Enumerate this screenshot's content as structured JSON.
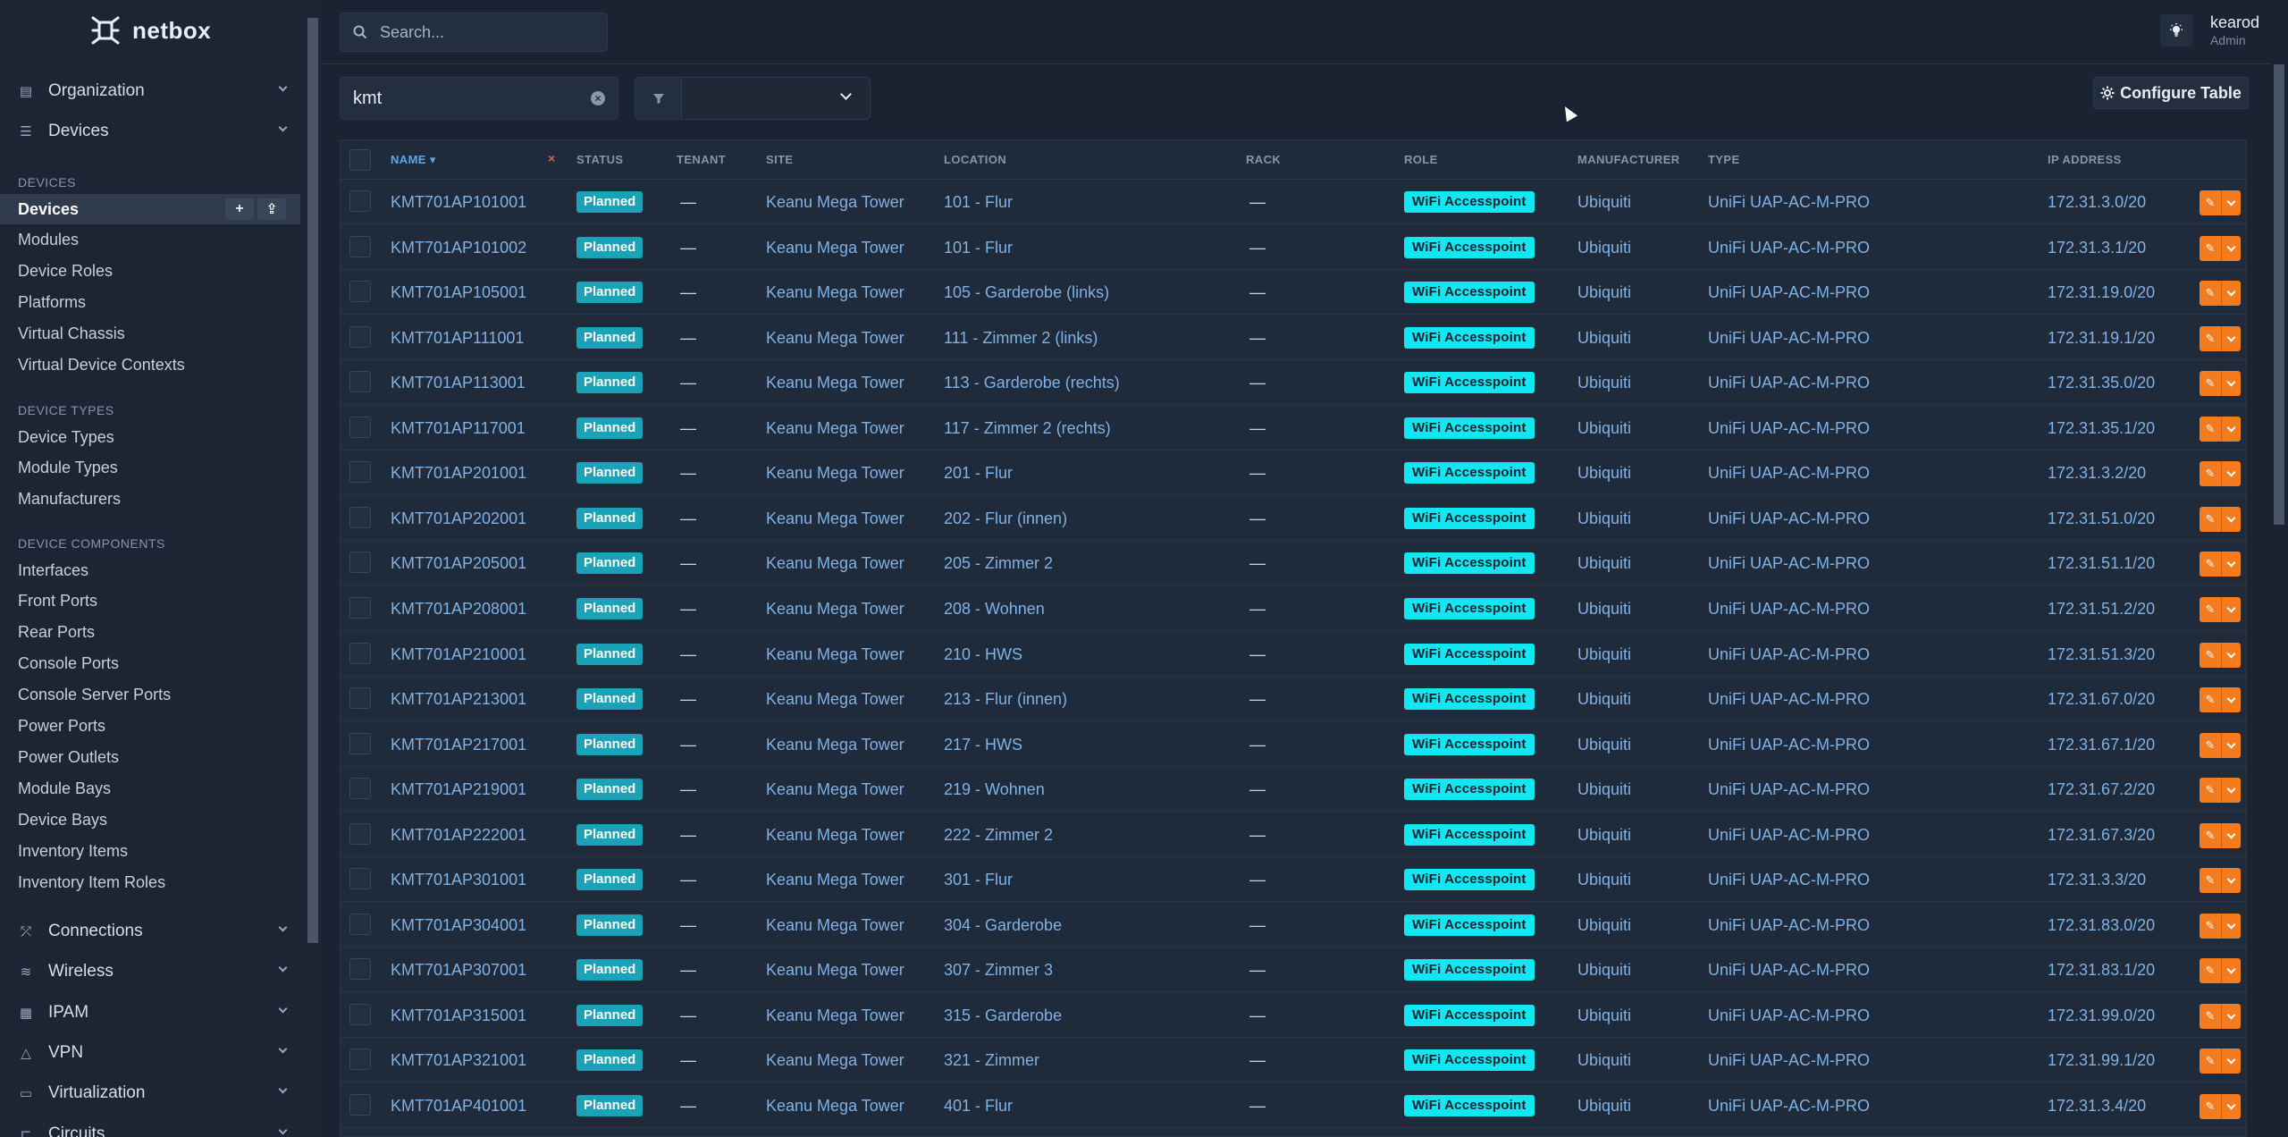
{
  "brand": {
    "name": "netbox"
  },
  "search": {
    "placeholder": "Search..."
  },
  "user": {
    "name": "kearod",
    "role": "Admin"
  },
  "sidebar": {
    "groups_top": [
      {
        "label": "Organization",
        "icon": "building-icon"
      },
      {
        "label": "Devices",
        "icon": "server-icon"
      }
    ],
    "sections": [
      {
        "title": "Devices",
        "items": [
          "Devices",
          "Modules",
          "Device Roles",
          "Platforms",
          "Virtual Chassis",
          "Virtual Device Contexts"
        ]
      },
      {
        "title": "Device Types",
        "items": [
          "Device Types",
          "Module Types",
          "Manufacturers"
        ]
      },
      {
        "title": "Device Components",
        "items": [
          "Interfaces",
          "Front Ports",
          "Rear Ports",
          "Console Ports",
          "Console Server Ports",
          "Power Ports",
          "Power Outlets",
          "Module Bays",
          "Device Bays",
          "Inventory Items",
          "Inventory Item Roles"
        ]
      }
    ],
    "groups_bottom": [
      {
        "label": "Connections",
        "icon": "connections-icon"
      },
      {
        "label": "Wireless",
        "icon": "wifi-icon"
      },
      {
        "label": "IPAM",
        "icon": "ipam-icon"
      },
      {
        "label": "VPN",
        "icon": "vpn-icon"
      },
      {
        "label": "Virtualization",
        "icon": "monitor-icon"
      },
      {
        "label": "Circuits",
        "icon": "circuits-icon"
      }
    ],
    "active_item": "Devices",
    "add_symbol": "+",
    "import_symbol": "⇪"
  },
  "filter": {
    "quick_search": "kmt",
    "selected": ""
  },
  "toolbar": {
    "configure_label": "Configure Table"
  },
  "table": {
    "columns": [
      "Name",
      "Status",
      "Tenant",
      "Site",
      "Location",
      "Rack",
      "Role",
      "Manufacturer",
      "Type",
      "IP Address"
    ],
    "sorted_column": "Name",
    "clear_sort_symbol": "×",
    "rows": [
      {
        "name": "KMT701AP101001",
        "status": "Planned",
        "tenant": "—",
        "site": "Keanu Mega Tower",
        "location": "101 - Flur",
        "rack": "—",
        "role": "WiFi Accesspoint",
        "manufacturer": "Ubiquiti",
        "type": "UniFi UAP-AC-M-PRO",
        "ip": "172.31.3.0/20"
      },
      {
        "name": "KMT701AP101002",
        "status": "Planned",
        "tenant": "—",
        "site": "Keanu Mega Tower",
        "location": "101 - Flur",
        "rack": "—",
        "role": "WiFi Accesspoint",
        "manufacturer": "Ubiquiti",
        "type": "UniFi UAP-AC-M-PRO",
        "ip": "172.31.3.1/20"
      },
      {
        "name": "KMT701AP105001",
        "status": "Planned",
        "tenant": "—",
        "site": "Keanu Mega Tower",
        "location": "105 - Garderobe (links)",
        "rack": "—",
        "role": "WiFi Accesspoint",
        "manufacturer": "Ubiquiti",
        "type": "UniFi UAP-AC-M-PRO",
        "ip": "172.31.19.0/20"
      },
      {
        "name": "KMT701AP111001",
        "status": "Planned",
        "tenant": "—",
        "site": "Keanu Mega Tower",
        "location": "111 - Zimmer 2 (links)",
        "rack": "—",
        "role": "WiFi Accesspoint",
        "manufacturer": "Ubiquiti",
        "type": "UniFi UAP-AC-M-PRO",
        "ip": "172.31.19.1/20"
      },
      {
        "name": "KMT701AP113001",
        "status": "Planned",
        "tenant": "—",
        "site": "Keanu Mega Tower",
        "location": "113 - Garderobe (rechts)",
        "rack": "—",
        "role": "WiFi Accesspoint",
        "manufacturer": "Ubiquiti",
        "type": "UniFi UAP-AC-M-PRO",
        "ip": "172.31.35.0/20"
      },
      {
        "name": "KMT701AP117001",
        "status": "Planned",
        "tenant": "—",
        "site": "Keanu Mega Tower",
        "location": "117 - Zimmer 2 (rechts)",
        "rack": "—",
        "role": "WiFi Accesspoint",
        "manufacturer": "Ubiquiti",
        "type": "UniFi UAP-AC-M-PRO",
        "ip": "172.31.35.1/20"
      },
      {
        "name": "KMT701AP201001",
        "status": "Planned",
        "tenant": "—",
        "site": "Keanu Mega Tower",
        "location": "201 - Flur",
        "rack": "—",
        "role": "WiFi Accesspoint",
        "manufacturer": "Ubiquiti",
        "type": "UniFi UAP-AC-M-PRO",
        "ip": "172.31.3.2/20"
      },
      {
        "name": "KMT701AP202001",
        "status": "Planned",
        "tenant": "—",
        "site": "Keanu Mega Tower",
        "location": "202 - Flur (innen)",
        "rack": "—",
        "role": "WiFi Accesspoint",
        "manufacturer": "Ubiquiti",
        "type": "UniFi UAP-AC-M-PRO",
        "ip": "172.31.51.0/20"
      },
      {
        "name": "KMT701AP205001",
        "status": "Planned",
        "tenant": "—",
        "site": "Keanu Mega Tower",
        "location": "205 - Zimmer 2",
        "rack": "—",
        "role": "WiFi Accesspoint",
        "manufacturer": "Ubiquiti",
        "type": "UniFi UAP-AC-M-PRO",
        "ip": "172.31.51.1/20"
      },
      {
        "name": "KMT701AP208001",
        "status": "Planned",
        "tenant": "—",
        "site": "Keanu Mega Tower",
        "location": "208 - Wohnen",
        "rack": "—",
        "role": "WiFi Accesspoint",
        "manufacturer": "Ubiquiti",
        "type": "UniFi UAP-AC-M-PRO",
        "ip": "172.31.51.2/20"
      },
      {
        "name": "KMT701AP210001",
        "status": "Planned",
        "tenant": "—",
        "site": "Keanu Mega Tower",
        "location": "210 - HWS",
        "rack": "—",
        "role": "WiFi Accesspoint",
        "manufacturer": "Ubiquiti",
        "type": "UniFi UAP-AC-M-PRO",
        "ip": "172.31.51.3/20"
      },
      {
        "name": "KMT701AP213001",
        "status": "Planned",
        "tenant": "—",
        "site": "Keanu Mega Tower",
        "location": "213 - Flur (innen)",
        "rack": "—",
        "role": "WiFi Accesspoint",
        "manufacturer": "Ubiquiti",
        "type": "UniFi UAP-AC-M-PRO",
        "ip": "172.31.67.0/20"
      },
      {
        "name": "KMT701AP217001",
        "status": "Planned",
        "tenant": "—",
        "site": "Keanu Mega Tower",
        "location": "217 - HWS",
        "rack": "—",
        "role": "WiFi Accesspoint",
        "manufacturer": "Ubiquiti",
        "type": "UniFi UAP-AC-M-PRO",
        "ip": "172.31.67.1/20"
      },
      {
        "name": "KMT701AP219001",
        "status": "Planned",
        "tenant": "—",
        "site": "Keanu Mega Tower",
        "location": "219 - Wohnen",
        "rack": "—",
        "role": "WiFi Accesspoint",
        "manufacturer": "Ubiquiti",
        "type": "UniFi UAP-AC-M-PRO",
        "ip": "172.31.67.2/20"
      },
      {
        "name": "KMT701AP222001",
        "status": "Planned",
        "tenant": "—",
        "site": "Keanu Mega Tower",
        "location": "222 - Zimmer 2",
        "rack": "—",
        "role": "WiFi Accesspoint",
        "manufacturer": "Ubiquiti",
        "type": "UniFi UAP-AC-M-PRO",
        "ip": "172.31.67.3/20"
      },
      {
        "name": "KMT701AP301001",
        "status": "Planned",
        "tenant": "—",
        "site": "Keanu Mega Tower",
        "location": "301 - Flur",
        "rack": "—",
        "role": "WiFi Accesspoint",
        "manufacturer": "Ubiquiti",
        "type": "UniFi UAP-AC-M-PRO",
        "ip": "172.31.3.3/20"
      },
      {
        "name": "KMT701AP304001",
        "status": "Planned",
        "tenant": "—",
        "site": "Keanu Mega Tower",
        "location": "304 - Garderobe",
        "rack": "—",
        "role": "WiFi Accesspoint",
        "manufacturer": "Ubiquiti",
        "type": "UniFi UAP-AC-M-PRO",
        "ip": "172.31.83.0/20"
      },
      {
        "name": "KMT701AP307001",
        "status": "Planned",
        "tenant": "—",
        "site": "Keanu Mega Tower",
        "location": "307 - Zimmer 3",
        "rack": "—",
        "role": "WiFi Accesspoint",
        "manufacturer": "Ubiquiti",
        "type": "UniFi UAP-AC-M-PRO",
        "ip": "172.31.83.1/20"
      },
      {
        "name": "KMT701AP315001",
        "status": "Planned",
        "tenant": "—",
        "site": "Keanu Mega Tower",
        "location": "315 - Garderobe",
        "rack": "—",
        "role": "WiFi Accesspoint",
        "manufacturer": "Ubiquiti",
        "type": "UniFi UAP-AC-M-PRO",
        "ip": "172.31.99.0/20"
      },
      {
        "name": "KMT701AP321001",
        "status": "Planned",
        "tenant": "—",
        "site": "Keanu Mega Tower",
        "location": "321 - Zimmer",
        "rack": "—",
        "role": "WiFi Accesspoint",
        "manufacturer": "Ubiquiti",
        "type": "UniFi UAP-AC-M-PRO",
        "ip": "172.31.99.1/20"
      },
      {
        "name": "KMT701AP401001",
        "status": "Planned",
        "tenant": "—",
        "site": "Keanu Mega Tower",
        "location": "401 - Flur",
        "rack": "—",
        "role": "WiFi Accesspoint",
        "manufacturer": "Ubiquiti",
        "type": "UniFi UAP-AC-M-PRO",
        "ip": "172.31.3.4/20"
      }
    ]
  },
  "colors": {
    "accent": "#7fb2e5",
    "status_planned": "#1aa2b8",
    "role_wifi": "#12e6f0",
    "action": "#f57c1e",
    "background": "#1a2332"
  }
}
